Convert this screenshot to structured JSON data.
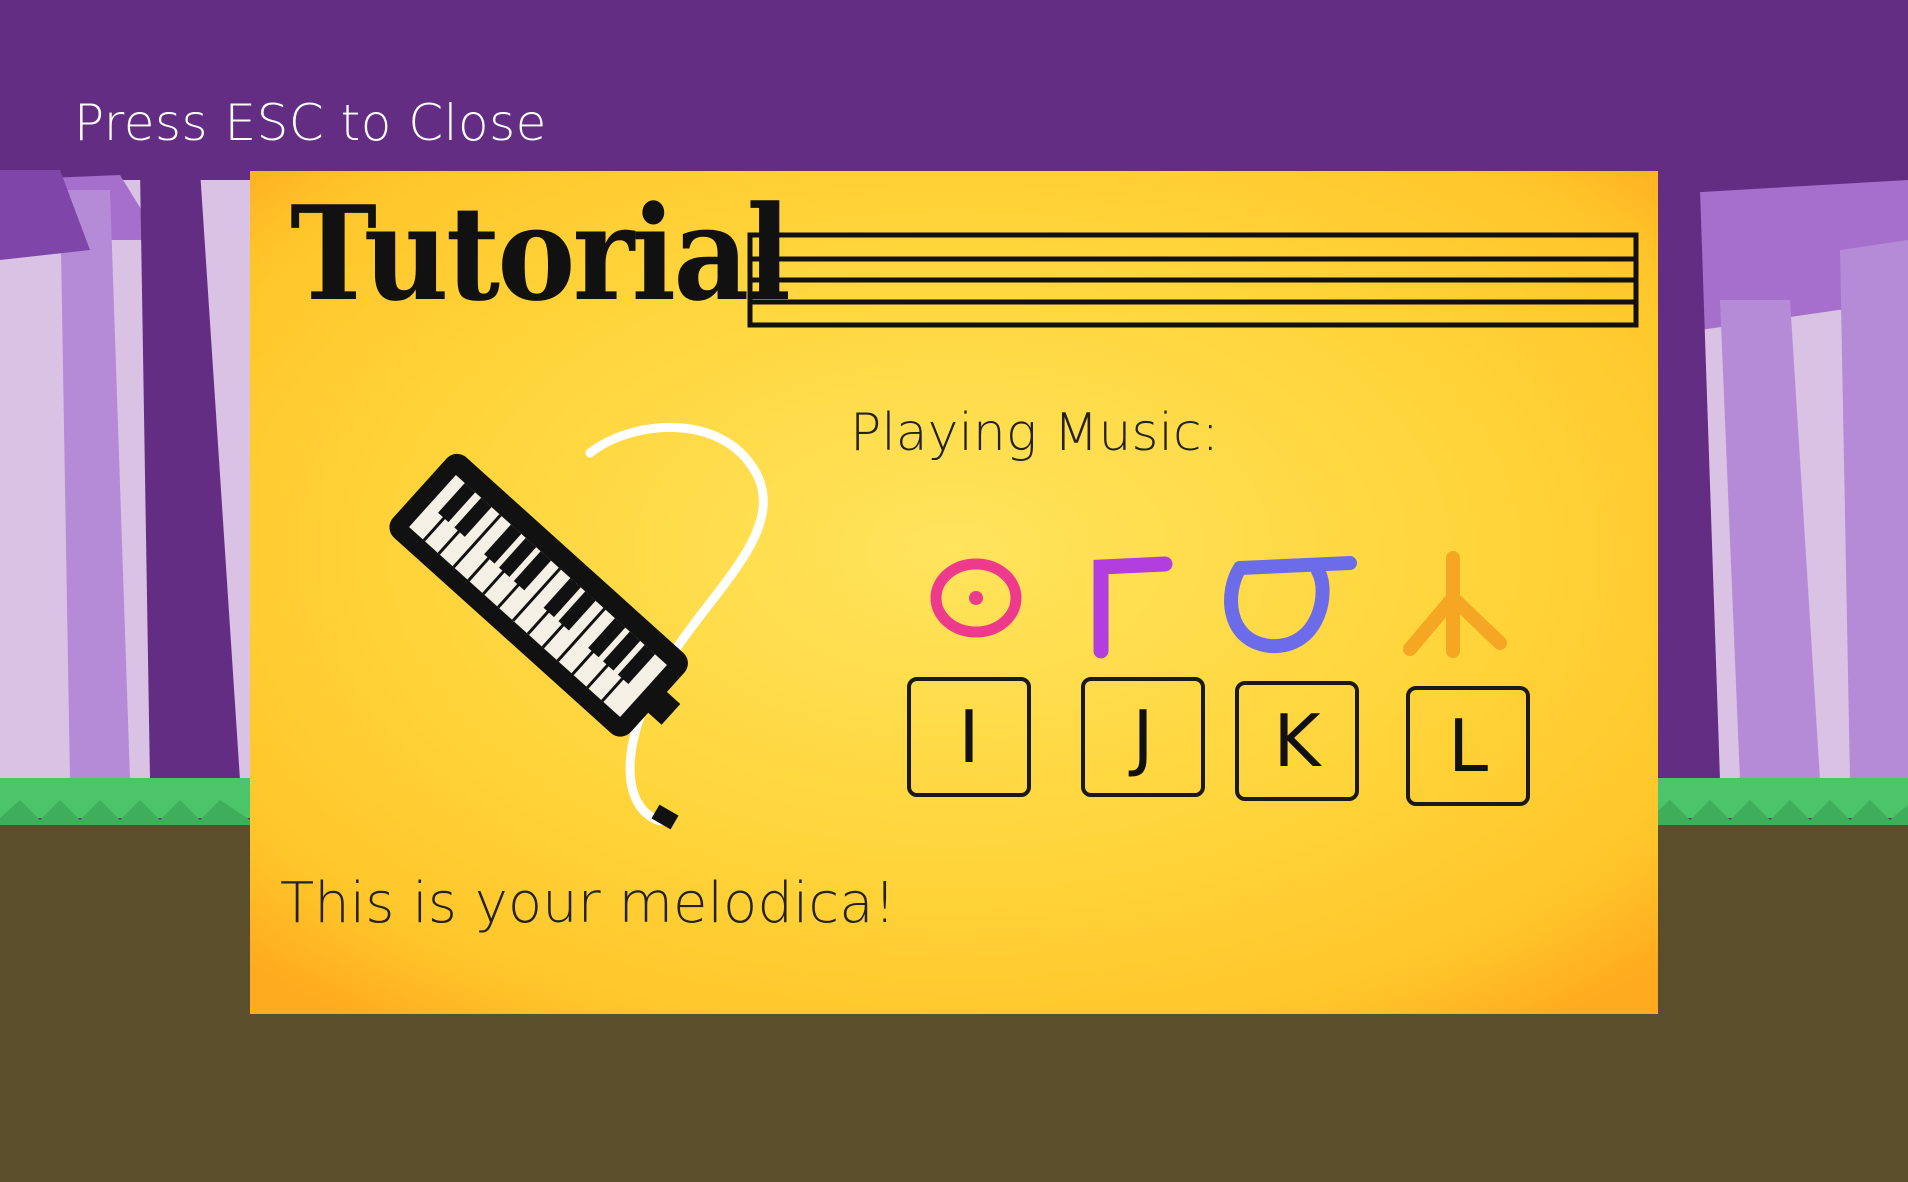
{
  "hud": {
    "esc_hint": "Press ESC to Close"
  },
  "tutorial": {
    "title": "Tutorial",
    "music_label": "Playing Music:",
    "melodica_caption": "This is your melodica!",
    "keys": [
      {
        "label": "I",
        "symbol": "circle-dot-rune-icon",
        "color": "#ee3a8c"
      },
      {
        "label": "J",
        "symbol": "gamma-rune-icon",
        "color": "#b23ee0"
      },
      {
        "label": "K",
        "symbol": "horseshoe-rune-icon",
        "color": "#6c6cea"
      },
      {
        "label": "L",
        "symbol": "fork-rune-icon",
        "color": "#f5a623"
      }
    ]
  },
  "colors": {
    "sky": "#632d84",
    "ground": "#5b4e2a",
    "grass": "#4bc46a",
    "panel": "#ffd84a"
  }
}
